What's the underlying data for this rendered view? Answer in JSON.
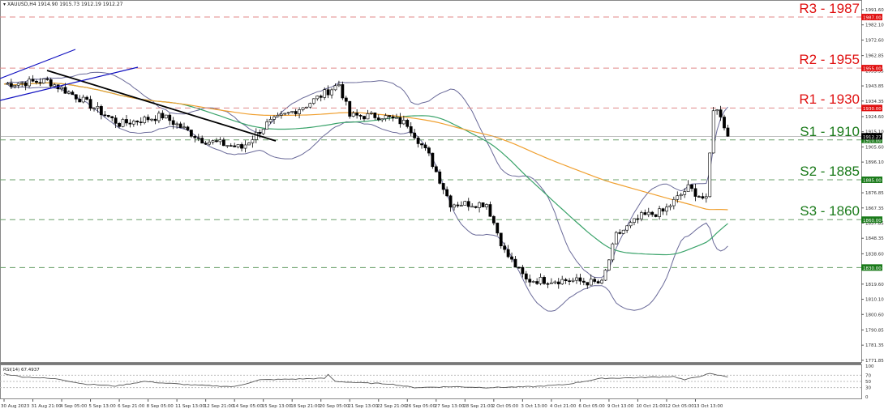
{
  "header": {
    "symbol": "XAUUSD,H4",
    "ohlc": "1914.90 1915.73 1912.19 1912.27"
  },
  "colors": {
    "resistance": "#e01010",
    "support": "#1a7a1a",
    "bollinger": "#6a6a99",
    "ma_fast": "#3aa36a",
    "ma_slow": "#f0a030",
    "trend_black": "#000000",
    "trend_blue": "#1010c0",
    "bull": "#ffffff",
    "bear": "#000000"
  },
  "price_axis": {
    "ticks": [
      "1991.60",
      "1982.10",
      "1972.60",
      "1962.85",
      "1953.35",
      "1943.85",
      "1934.35",
      "1924.60",
      "1915.10",
      "1905.60",
      "1896.10",
      "1876.85",
      "1867.35",
      "1857.85",
      "1848.35",
      "1838.60",
      "1819.60",
      "1810.10",
      "1800.60",
      "1790.85",
      "1781.35",
      "1771.85"
    ],
    "current_price": "1912.27"
  },
  "levels": [
    {
      "label": "R3 - 1987",
      "price": 1987,
      "tag": "1987.00",
      "type": "resistance"
    },
    {
      "label": "R2 - 1955",
      "price": 1955,
      "tag": "1955.00",
      "type": "resistance"
    },
    {
      "label": "R1 - 1930",
      "price": 1930,
      "tag": "1930.00",
      "type": "resistance"
    },
    {
      "label": "S1 - 1910",
      "price": 1910,
      "tag": "1910.00",
      "type": "support"
    },
    {
      "label": "S2 - 1885",
      "price": 1885,
      "tag": "1885.00",
      "type": "support"
    },
    {
      "label": "S3 - 1860",
      "price": 1860,
      "tag": "1860.00",
      "type": "support"
    },
    {
      "label": "",
      "price": 1830,
      "tag": "1830.00",
      "type": "support"
    }
  ],
  "price_path": [
    [
      0,
      1945
    ],
    [
      12,
      1947
    ],
    [
      21,
      1936
    ],
    [
      32,
      1920
    ],
    [
      44,
      1925
    ],
    [
      55,
      1910
    ],
    [
      66,
      1905
    ],
    [
      73,
      1920
    ],
    [
      84,
      1932
    ],
    [
      93,
      1945
    ],
    [
      96,
      1925
    ],
    [
      105,
      1925
    ],
    [
      112,
      1920
    ],
    [
      118,
      1900
    ],
    [
      124,
      1870
    ],
    [
      134,
      1870
    ],
    [
      139,
      1840
    ],
    [
      145,
      1822
    ],
    [
      157,
      1822
    ],
    [
      166,
      1820
    ],
    [
      170,
      1850
    ],
    [
      177,
      1862
    ],
    [
      183,
      1865
    ],
    [
      190,
      1880
    ],
    [
      195,
      1872
    ],
    [
      197,
      1930
    ],
    [
      199,
      1926
    ],
    [
      201,
      1912
    ]
  ],
  "rsi": {
    "label": "RSI(14) 67.4937",
    "levels": [
      "100",
      "70",
      "50",
      "30",
      "0"
    ],
    "path": [
      [
        0,
        75
      ],
      [
        5,
        65
      ],
      [
        15,
        58
      ],
      [
        22,
        42
      ],
      [
        31,
        35
      ],
      [
        39,
        50
      ],
      [
        44,
        45
      ],
      [
        53,
        38
      ],
      [
        64,
        33
      ],
      [
        71,
        55
      ],
      [
        89,
        60
      ],
      [
        90,
        72
      ],
      [
        92,
        50
      ],
      [
        100,
        45
      ],
      [
        107,
        42
      ],
      [
        114,
        30
      ],
      [
        125,
        33
      ],
      [
        134,
        30
      ],
      [
        143,
        32
      ],
      [
        147,
        33
      ],
      [
        156,
        40
      ],
      [
        166,
        60
      ],
      [
        175,
        62
      ],
      [
        186,
        66
      ],
      [
        189,
        55
      ],
      [
        196,
        75
      ],
      [
        201,
        65
      ]
    ]
  },
  "time_axis": [
    "30 Aug 2023",
    "31 Aug 21:00",
    "4 Sep 05:00",
    "5 Sep 13:00",
    "6 Sep 21:00",
    "8 Sep 05:00",
    "11 Sep 13:00",
    "12 Sep 21:00",
    "14 Sep 05:00",
    "15 Sep 13:00",
    "18 Sep 21:00",
    "20 Sep 05:00",
    "21 Sep 13:00",
    "22 Sep 21:00",
    "26 Sep 05:00",
    "27 Sep 13:00",
    "28 Sep 21:00",
    "2 Oct 05:00",
    "3 Oct 13:00",
    "4 Oct 21:00",
    "6 Oct 05:00",
    "9 Oct 13:00",
    "10 Oct 21:00",
    "12 Oct 05:00",
    "13 Oct 13:00"
  ]
}
